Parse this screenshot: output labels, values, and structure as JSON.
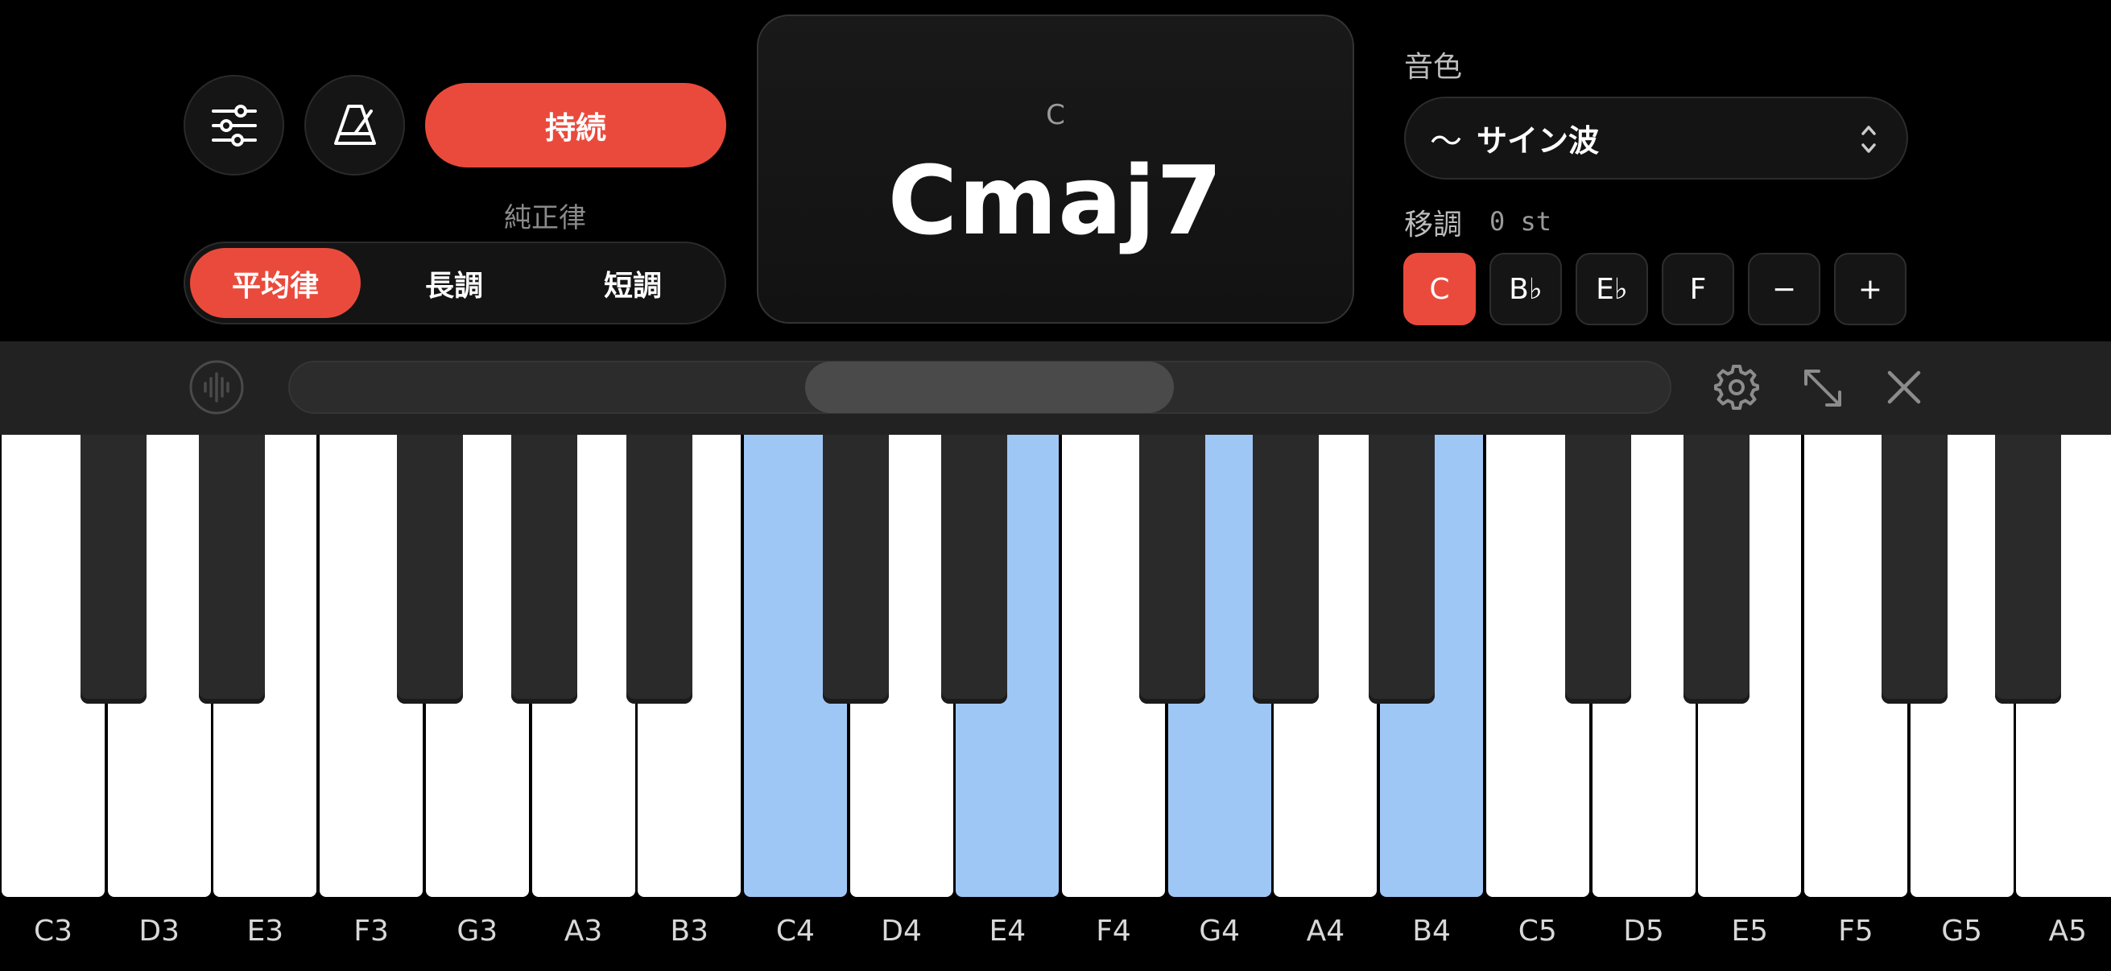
{
  "controls": {
    "mixer_icon": "sliders-icon",
    "metronome_icon": "metronome-icon",
    "sustain_label": "持続",
    "tuning_caption": "純正律",
    "temperament": [
      "平均律",
      "長調",
      "短調"
    ],
    "temperament_selected": "平均律"
  },
  "chord": {
    "root": "C",
    "name": "Cmaj7"
  },
  "tone": {
    "label": "音色",
    "wave_icon": "〜",
    "value": "サイン波"
  },
  "transpose": {
    "label": "移調",
    "value": "0 st",
    "keys": [
      "C",
      "B♭",
      "E♭",
      "F",
      "−",
      "+"
    ],
    "selected": "C"
  },
  "toolbar": {
    "icons": [
      "waveform-icon",
      "gear-icon",
      "expand-icon",
      "close-icon"
    ],
    "scroll_position": 0.32
  },
  "keyboard": {
    "white_keys": [
      "C3",
      "D3",
      "E3",
      "F3",
      "G3",
      "A3",
      "B3",
      "C4",
      "D4",
      "E4",
      "F4",
      "G4",
      "A4",
      "B4",
      "C5",
      "D5",
      "E5",
      "F5",
      "G5",
      "A5"
    ],
    "highlighted": [
      "C4",
      "E4",
      "G4",
      "B4"
    ],
    "colors": {
      "highlight": "#9fc7f5",
      "accent": "#ea4a3c"
    }
  }
}
